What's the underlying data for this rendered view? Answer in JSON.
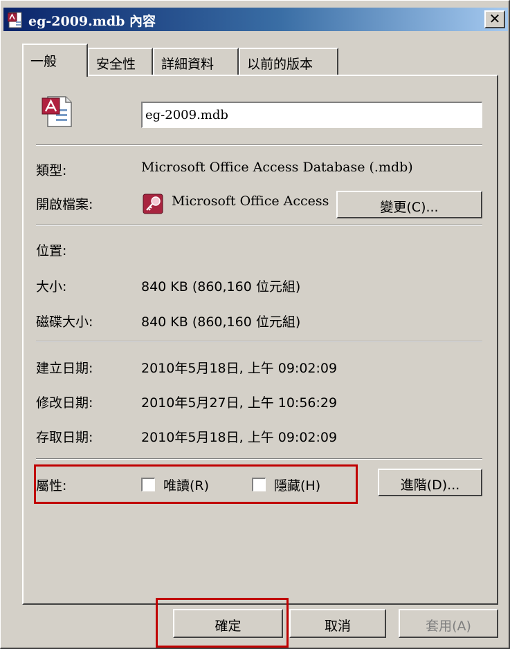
{
  "window": {
    "title": "eg-2009.mdb 內容",
    "close_label": "✕"
  },
  "tabs": [
    {
      "label": "一般",
      "active": true
    },
    {
      "label": "安全性",
      "active": false
    },
    {
      "label": "詳細資料",
      "active": false
    },
    {
      "label": "以前的版本",
      "active": false
    }
  ],
  "general": {
    "file_name": "eg-2009.mdb",
    "type_label": "類型:",
    "type_value": "Microsoft Office Access Database (.mdb)",
    "opens_with_label": "開啟檔案:",
    "opens_with_value": "Microsoft Office Access",
    "change_button": "變更(C)...",
    "location_label": "位置:",
    "location_value": "",
    "size_label": "大小:",
    "size_value": "840 KB (860,160 位元組)",
    "disk_size_label": "磁碟大小:",
    "disk_size_value": "840 KB (860,160 位元組)",
    "created_label": "建立日期:",
    "created_value": "2010年5月18日, 上午 09:02:09",
    "modified_label": "修改日期:",
    "modified_value": "2010年5月27日, 上午 10:56:29",
    "accessed_label": "存取日期:",
    "accessed_value": "2010年5月18日, 上午 09:02:09",
    "attributes_label": "屬性:",
    "readonly_label": "唯讀(R)",
    "readonly_checked": false,
    "hidden_label": "隱藏(H)",
    "hidden_checked": false,
    "advanced_button": "進階(D)..."
  },
  "footer": {
    "ok_button": "確定",
    "cancel_button": "取消",
    "apply_button": "套用(A)",
    "apply_disabled": true
  },
  "colors": {
    "titlebar_start": "#0a246a",
    "titlebar_end": "#a6caf0",
    "dialog_face": "#d4d0c8",
    "highlight_box": "#c00000"
  },
  "icons": {
    "title": "access-file-icon",
    "file": "access-database-icon",
    "app": "access-app-key-icon"
  }
}
